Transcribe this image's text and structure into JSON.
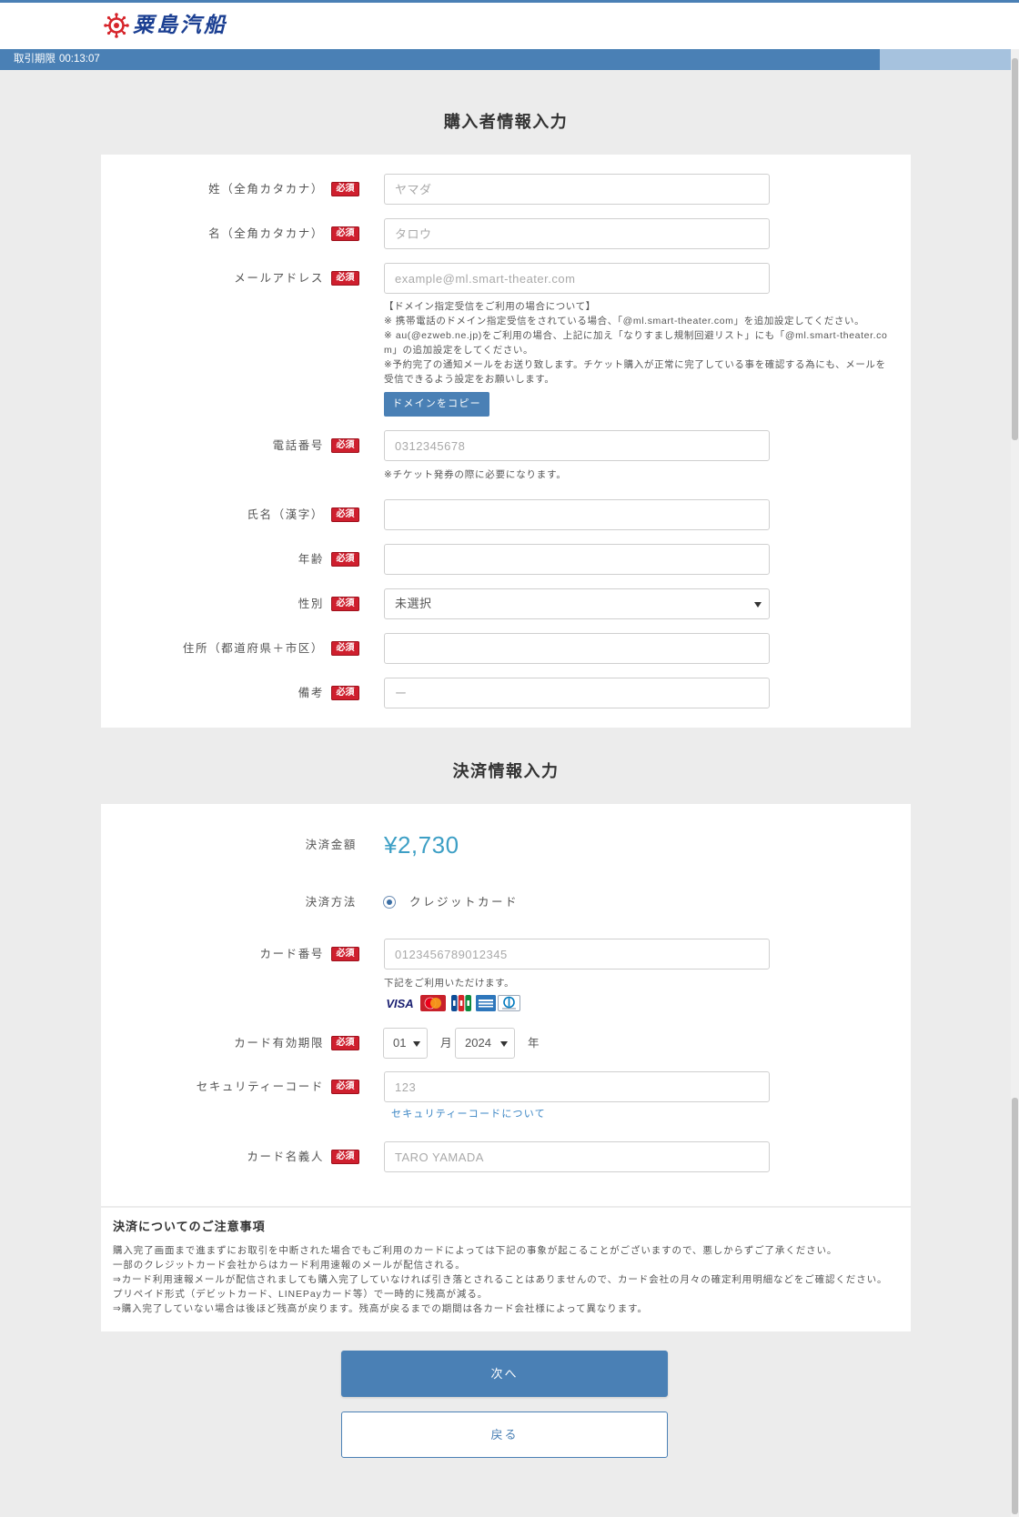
{
  "header": {
    "logo_text": "粟島汽船",
    "logo_icon": "ship-wheel-icon"
  },
  "timer": {
    "label": "取引期限",
    "value": "00:13:07",
    "remaining_fraction": 0.87
  },
  "purchaser": {
    "title": "購入者情報入力",
    "required_badge": "必須",
    "fields": {
      "last_name_kana": {
        "label": "姓（全角カタカナ）",
        "placeholder": "ヤマダ"
      },
      "first_name_kana": {
        "label": "名（全角カタカナ）",
        "placeholder": "タロウ"
      },
      "email": {
        "label": "メールアドレス",
        "placeholder": "example@ml.smart-theater.com"
      },
      "phone": {
        "label": "電話番号",
        "placeholder": "0312345678",
        "note": "※チケット発券の際に必要になります。"
      },
      "full_name_kanji": {
        "label": "氏名（漢字）"
      },
      "age": {
        "label": "年齢"
      },
      "gender": {
        "label": "性別",
        "selected": "未選択"
      },
      "address": {
        "label": "住所（都道府県＋市区）"
      },
      "remarks": {
        "label": "備考",
        "placeholder": "ー"
      }
    },
    "email_notes": [
      "【ドメイン指定受信をご利用の場合について】",
      "※ 携帯電話のドメイン指定受信をされている場合、「@ml.smart-theater.com」を追加設定してください。",
      "※ au(@ezweb.ne.jp)をご利用の場合、上記に加え「なりすまし規制回避リスト」にも「@ml.smart-theater.com」の追加設定をしてください。",
      "※予約完了の通知メールをお送り致します。チケット購入が正常に完了している事を確認する為にも、メールを受信できるよう設定をお願いします。"
    ],
    "copy_domain_button": "ドメインをコピー"
  },
  "payment": {
    "title": "決済情報入力",
    "required_badge": "必須",
    "amount": {
      "label": "決済金額",
      "value": "¥2,730"
    },
    "method": {
      "label": "決済方法",
      "option": "クレジットカード",
      "selected": true
    },
    "card_number": {
      "label": "カード番号",
      "placeholder": "0123456789012345",
      "note": "下記をご利用いただけます。"
    },
    "card_brands": [
      {
        "icon": "visa-logo-icon",
        "text": "VISA"
      },
      {
        "icon": "mastercard-logo-icon"
      },
      {
        "icon": "jcb-logo-icon"
      },
      {
        "icon": "amex-logo-icon"
      },
      {
        "icon": "diners-club-logo-icon"
      }
    ],
    "expiry": {
      "label": "カード有効期限",
      "month": "01",
      "month_unit": "月",
      "year": "2024",
      "year_unit": "年"
    },
    "security_code": {
      "label": "セキュリティーコード",
      "placeholder": "123",
      "help_link": "セキュリティーコードについて"
    },
    "card_holder": {
      "label": "カード名義人",
      "placeholder": "TARO YAMADA"
    }
  },
  "notice": {
    "title": "決済についてのご注意事項",
    "lines": [
      "購入完了画面まで進まずにお取引を中断された場合でもご利用のカードによっては下記の事象が起こることがございますので、悪しからずご了承ください。",
      "一部のクレジットカード会社からはカード利用速報のメールが配信される。",
      "⇒カード利用速報メールが配信されましても購入完了していなければ引き落とされることはありませんので、カード会社の月々の確定利用明細などをご確認ください。",
      "プリペイド形式（デビットカード、LINEPayカード等）で一時的に残高が減る。",
      "⇒購入完了していない場合は後ほど残高が戻ります。残高が戻るまでの期間は各カード会社様によって異なります。"
    ]
  },
  "actions": {
    "next": "次へ",
    "back": "戻る"
  },
  "colors": {
    "accent": "#4a80b5",
    "required": "#cf1f2e",
    "amount": "#3d9fc5",
    "link": "#3a85c4",
    "timer_rest": "#a6c2de"
  }
}
